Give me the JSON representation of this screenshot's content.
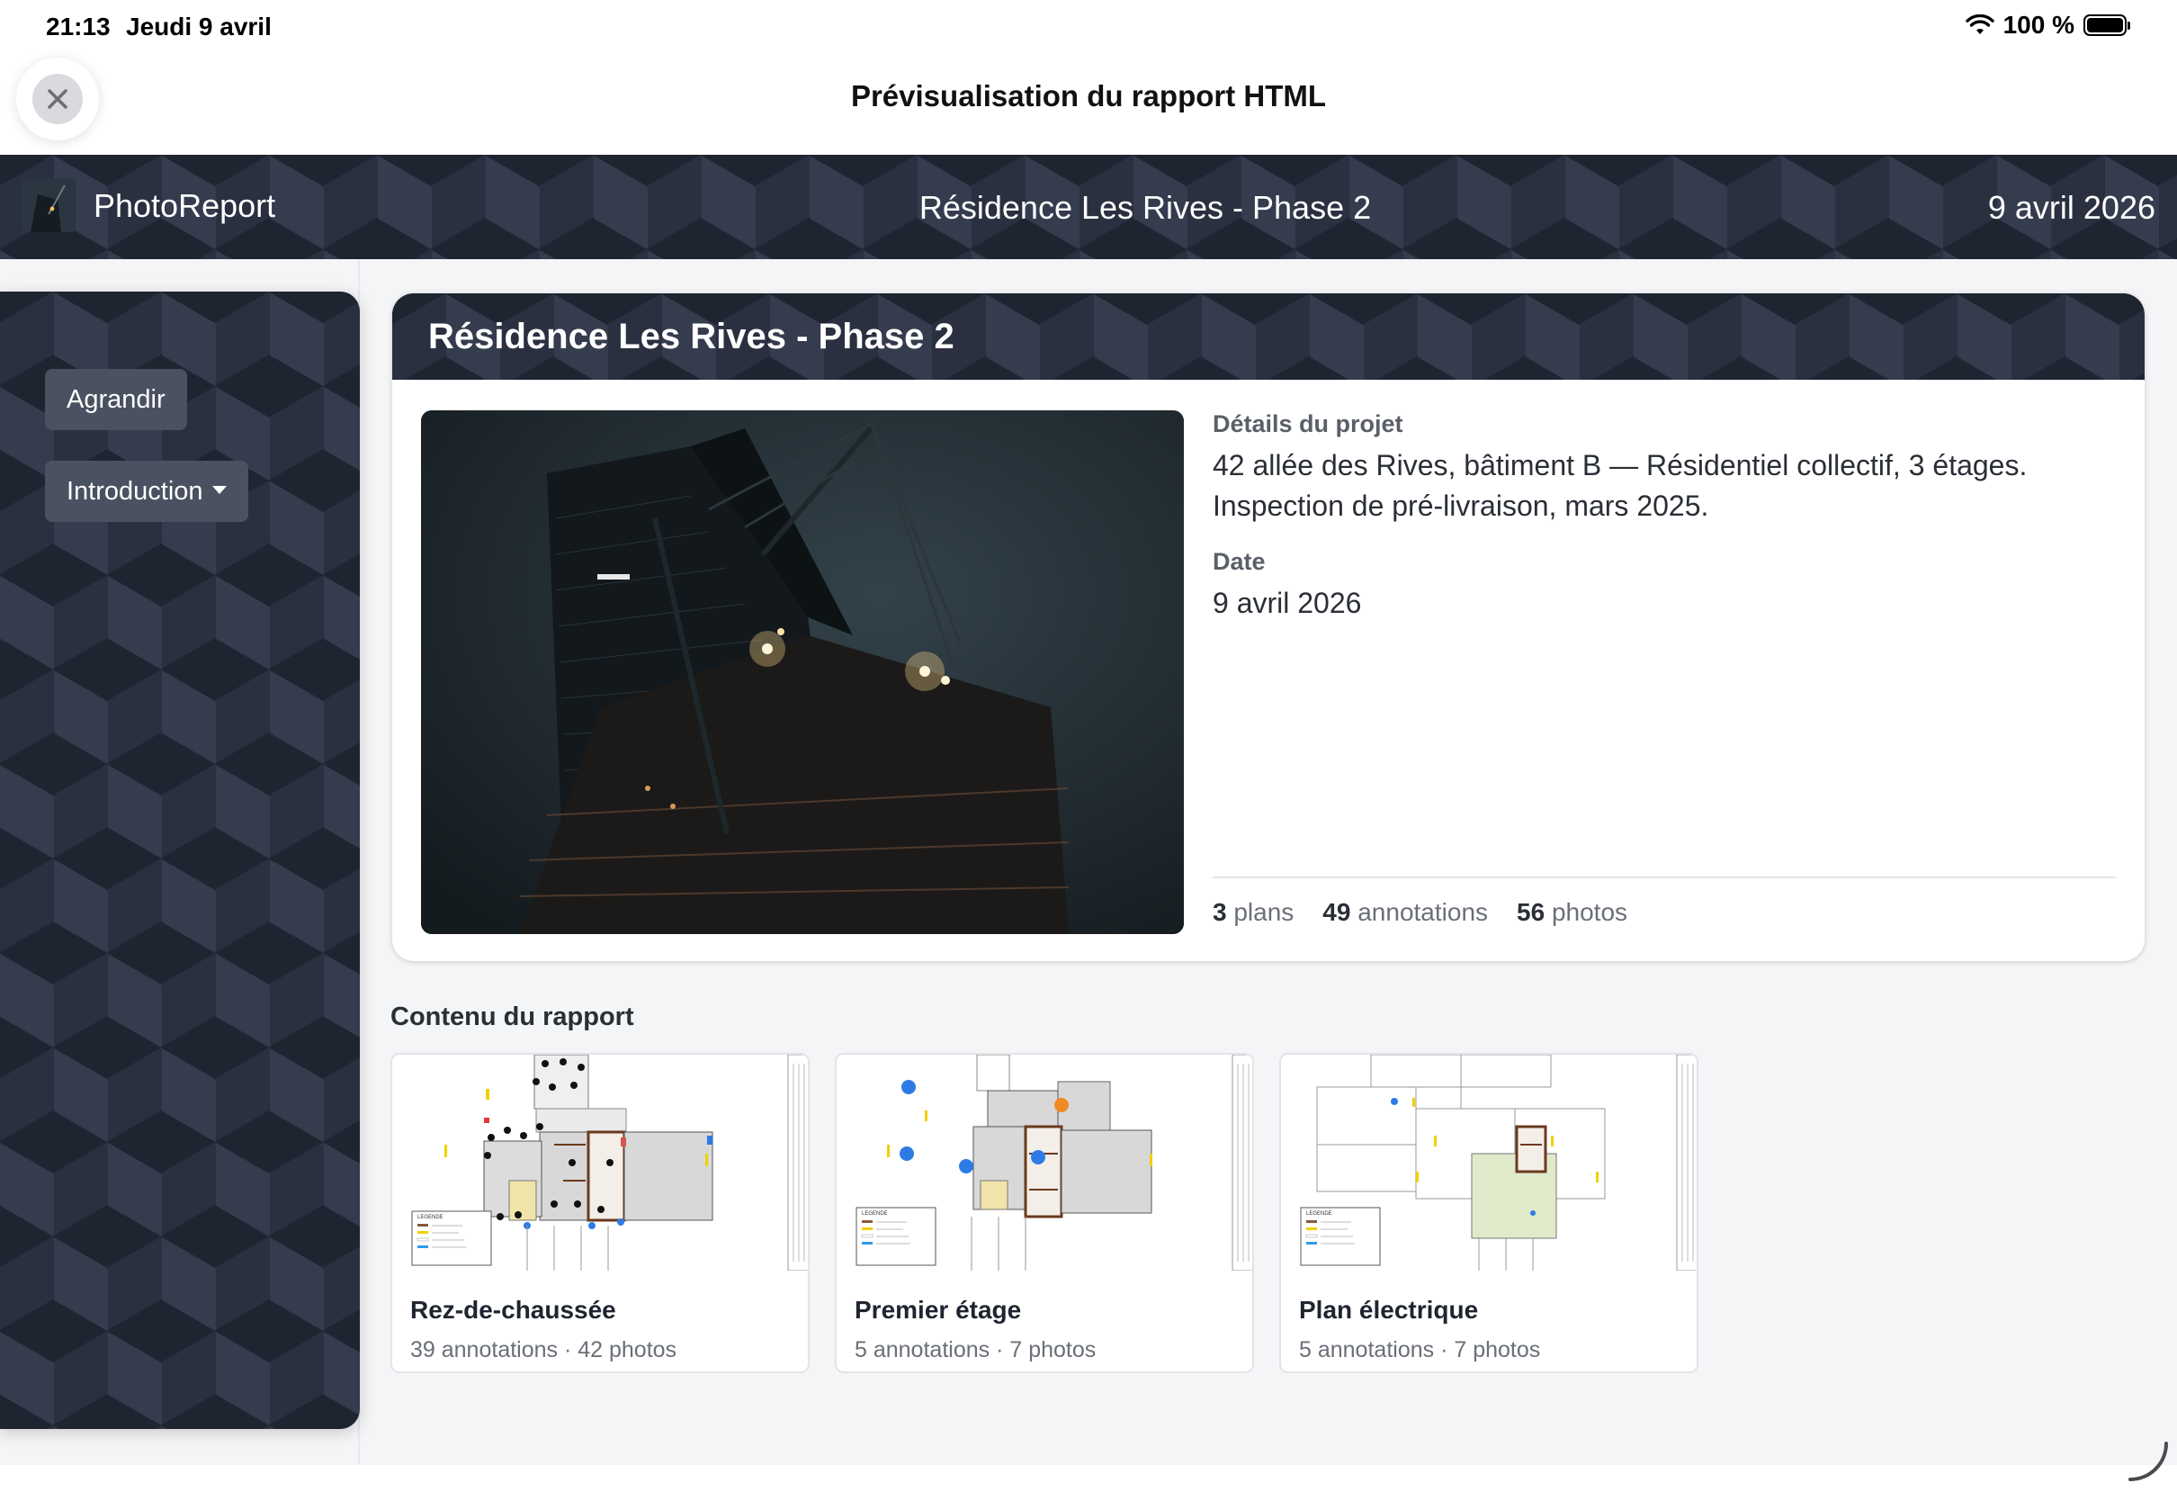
{
  "status_bar": {
    "time": "21:13",
    "date": "Jeudi 9 avril",
    "battery": "100 %"
  },
  "sheet": {
    "title": "Prévisualisation du rapport HTML"
  },
  "header": {
    "brand": "PhotoReport",
    "project": "Résidence Les Rives - Phase 2",
    "date": "9 avril 2026"
  },
  "sidebar": {
    "expand_label": "Agrandir",
    "section_label": "Introduction"
  },
  "project": {
    "title": "Résidence Les Rives - Phase 2",
    "details_label": "Détails du projet",
    "details_line1": "42 allée des Rives, bâtiment B — Résidentiel collectif, 3 étages.",
    "details_line2": "Inspection de pré-livraison, mars 2025.",
    "date_label": "Date",
    "date_value": "9 avril 2026",
    "stats": {
      "plans_count": "3",
      "plans_label": "plans",
      "annotations_count": "49",
      "annotations_label": "annotations",
      "photos_count": "56",
      "photos_label": "photos"
    }
  },
  "contents": {
    "title": "Contenu du rapport",
    "plans": [
      {
        "name": "Rez-de-chaussée",
        "meta": "39 annotations · 42 photos"
      },
      {
        "name": "Premier étage",
        "meta": "5 annotations · 7 photos"
      },
      {
        "name": "Plan électrique",
        "meta": "5 annotations · 7 photos"
      }
    ],
    "legend_title": "LEGENDE"
  },
  "colors": {
    "accent_dark": "#2a3040",
    "marker_blue": "#2e7be6",
    "marker_orange": "#f08a24"
  }
}
